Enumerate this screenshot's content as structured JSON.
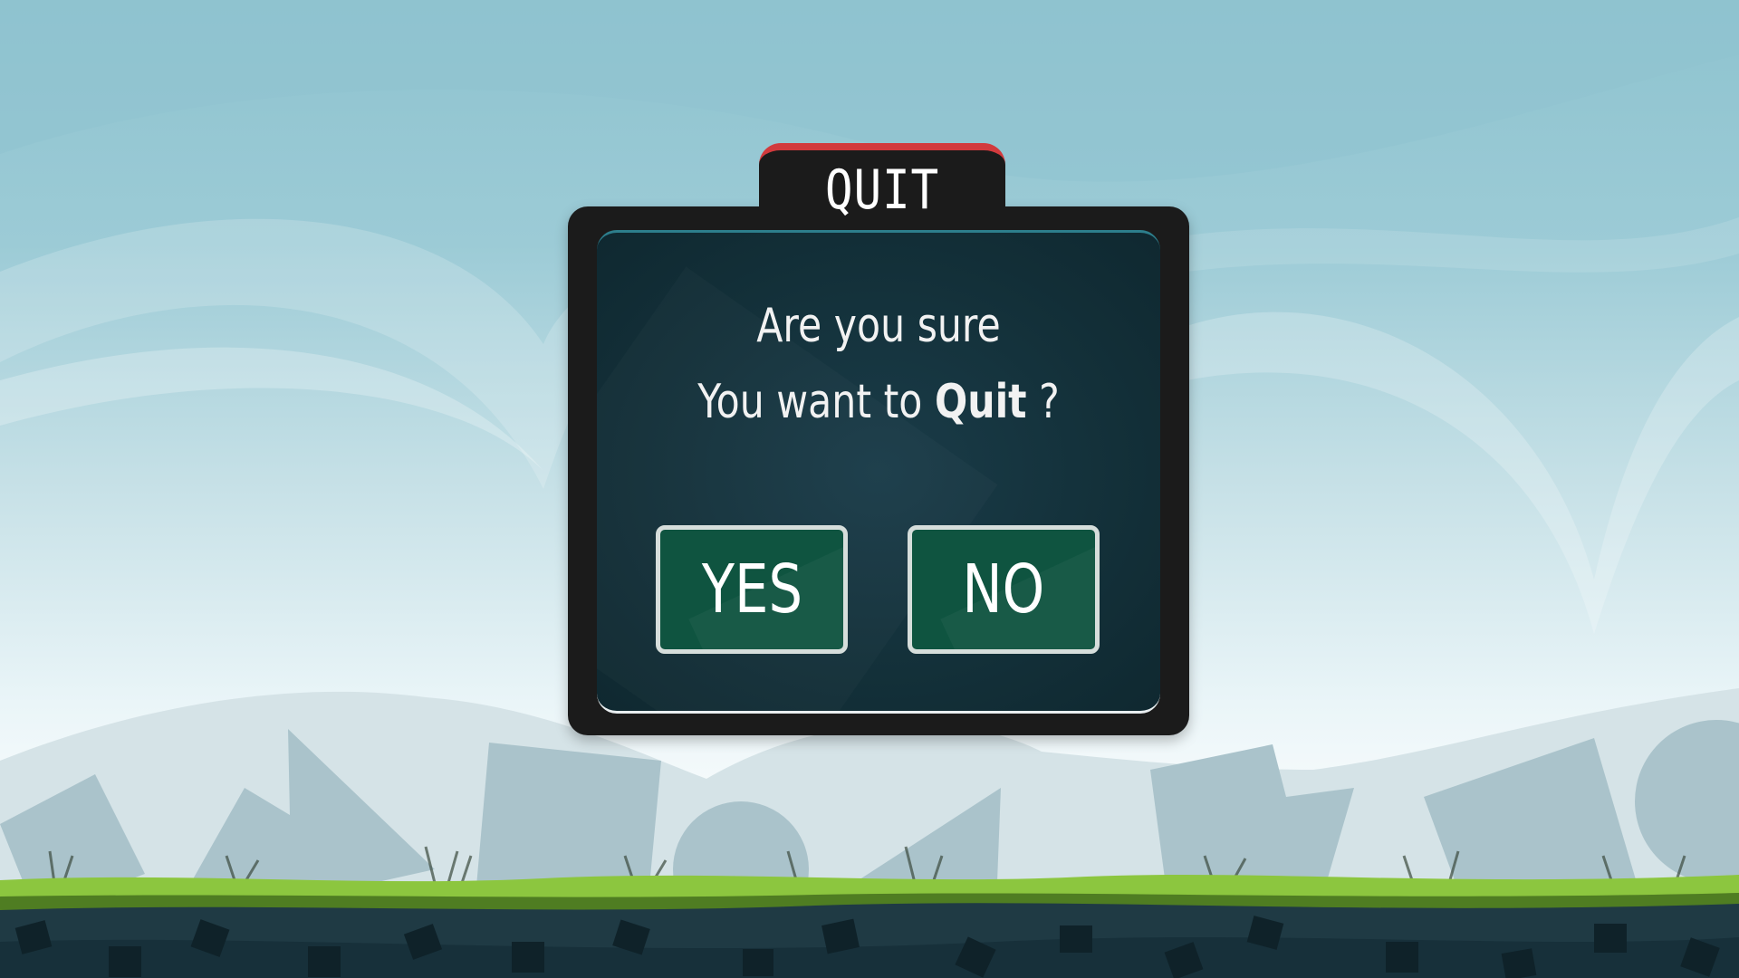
{
  "dialog": {
    "title": "QUIT",
    "message_line1": "Are you sure",
    "message_line2_prefix": "You want to ",
    "message_line2_emphasis": "Quit",
    "message_line2_suffix": " ?",
    "yes_label": "YES",
    "no_label": "NO"
  },
  "colors": {
    "title_accent": "#d23a3d",
    "panel": "#1b1b1b",
    "inner_panel": "#133039",
    "button": "#0f5440",
    "grass": "#8cc63f"
  }
}
